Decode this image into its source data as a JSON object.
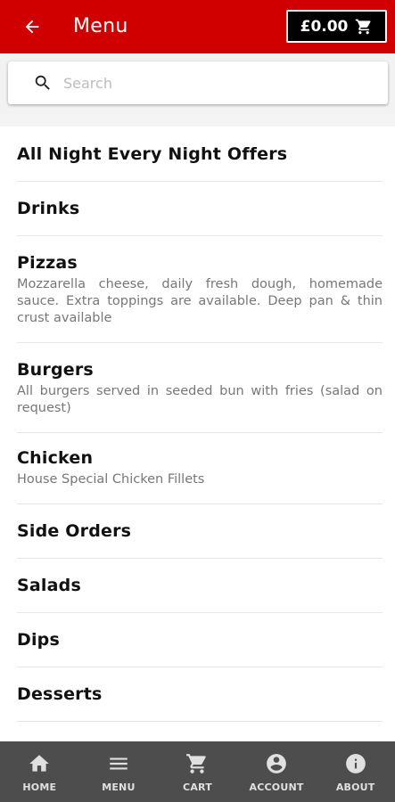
{
  "header": {
    "title": "Menu",
    "cart_total": "£0.00",
    "accent_color": "#d10000"
  },
  "search": {
    "placeholder": "Search",
    "value": ""
  },
  "categories": [
    {
      "name": "All Night Every Night Offers",
      "description": ""
    },
    {
      "name": "Drinks",
      "description": ""
    },
    {
      "name": "Pizzas",
      "description": "Mozzarella cheese, daily fresh dough, homemade sauce. Extra toppings are available. Deep pan & thin crust available"
    },
    {
      "name": "Burgers",
      "description": "All burgers served in seeded bun with fries (salad on request)"
    },
    {
      "name": "Chicken",
      "description": "House Special Chicken Fillets"
    },
    {
      "name": "Side Orders",
      "description": ""
    },
    {
      "name": "Salads",
      "description": ""
    },
    {
      "name": "Dips",
      "description": ""
    },
    {
      "name": "Desserts",
      "description": ""
    }
  ],
  "bottom_nav": {
    "items": [
      {
        "label": "HOME",
        "icon": "home-icon"
      },
      {
        "label": "MENU",
        "icon": "menu-icon"
      },
      {
        "label": "CART",
        "icon": "cart-icon"
      },
      {
        "label": "ACCOUNT",
        "icon": "account-icon"
      },
      {
        "label": "ABOUT",
        "icon": "info-icon"
      }
    ]
  }
}
